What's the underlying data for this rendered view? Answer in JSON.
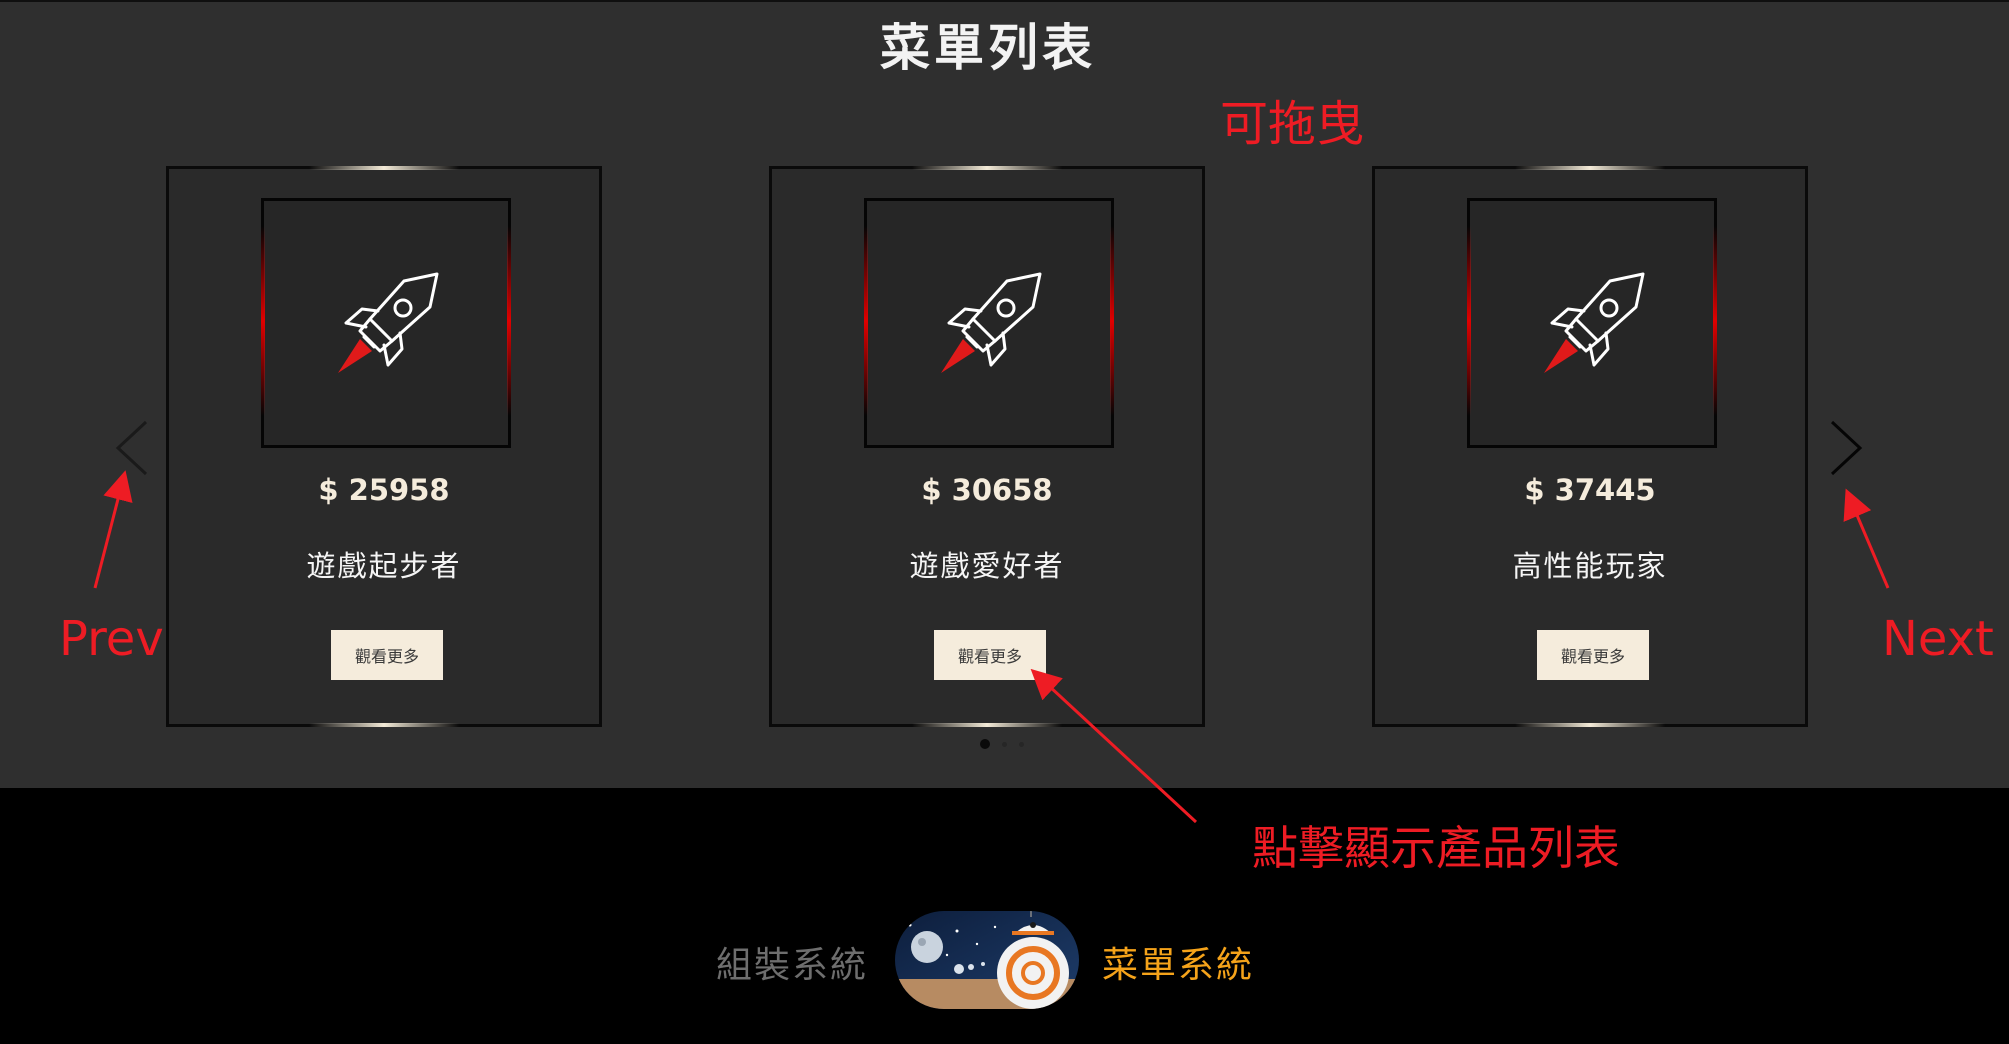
{
  "header": {
    "title": "菜單列表"
  },
  "carousel": {
    "cards": [
      {
        "price": "$ 25958",
        "name": "遊戲起步者",
        "button_label": "觀看更多",
        "icon": "rocket-icon"
      },
      {
        "price": "$ 30658",
        "name": "遊戲愛好者",
        "button_label": "觀看更多",
        "icon": "rocket-icon"
      },
      {
        "price": "$ 37445",
        "name": "高性能玩家",
        "button_label": "觀看更多",
        "icon": "rocket-icon"
      }
    ],
    "prev_icon": "chevron-left-icon",
    "next_icon": "chevron-right-icon",
    "page_count": 3,
    "active_page": 1
  },
  "annotations": {
    "draggable": "可拖曳",
    "prev": "Prev",
    "next": "Next",
    "click_hint": "點擊顯示產品列表"
  },
  "footer": {
    "left_label": "組裝系統",
    "right_label": "菜單系統",
    "toggle_icon": "bb8-space-toggle-icon"
  },
  "colors": {
    "background": "#2f2f2f",
    "card_border": "#0a0a0a",
    "accent_cream": "#f5ecdc",
    "accent_red": "#e00000",
    "annotation_red": "#ee1c24",
    "footer_active": "#f5a31a",
    "footer_inactive": "#6e6e6e"
  }
}
